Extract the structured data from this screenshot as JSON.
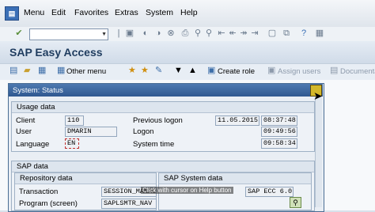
{
  "menubar": {
    "items": [
      "Menu",
      "Edit",
      "Favorites",
      "Extras",
      "System",
      "Help"
    ]
  },
  "toolbar": {
    "command_field": {
      "value": ""
    },
    "icons": [
      "save-icon",
      "back-icon",
      "exit-icon",
      "cancel-icon",
      "print-icon",
      "find-icon",
      "find-next-icon",
      "first-page-icon",
      "prev-page-icon",
      "next-page-icon",
      "last-page-icon",
      "new-session-icon",
      "shortcut-icon",
      "help-icon",
      "layout-icon"
    ]
  },
  "page": {
    "title": "SAP Easy Access"
  },
  "apptoolbar": {
    "other_menu": "Other menu",
    "create_role": "Create role",
    "assign_users": "Assign users",
    "documentation": "Documenta"
  },
  "dialog": {
    "title": "System: Status",
    "usage": {
      "header": "Usage data",
      "client_label": "Client",
      "client": "110",
      "user_label": "User",
      "user": "DMARIN",
      "language_label": "Language",
      "language": "EN",
      "prev_logon_label": "Previous logon",
      "prev_logon_date": "11.05.2015",
      "prev_logon_time": "08:37:48",
      "logon_label": "Logon",
      "logon_time": "09:49:56",
      "system_time_label": "System time",
      "system_time": "09:58:34"
    },
    "sap": {
      "header": "SAP data",
      "repository_header": "Repository data",
      "system_header": "SAP System data",
      "transaction_label": "Transaction",
      "transaction": "SESSION_MANAGER",
      "program_label": "Program (screen)",
      "program": "SAPLSMTR_NAV",
      "system_value": "SAP ECC 6.0",
      "tooltip": "Click with cursor on Help button"
    }
  }
}
